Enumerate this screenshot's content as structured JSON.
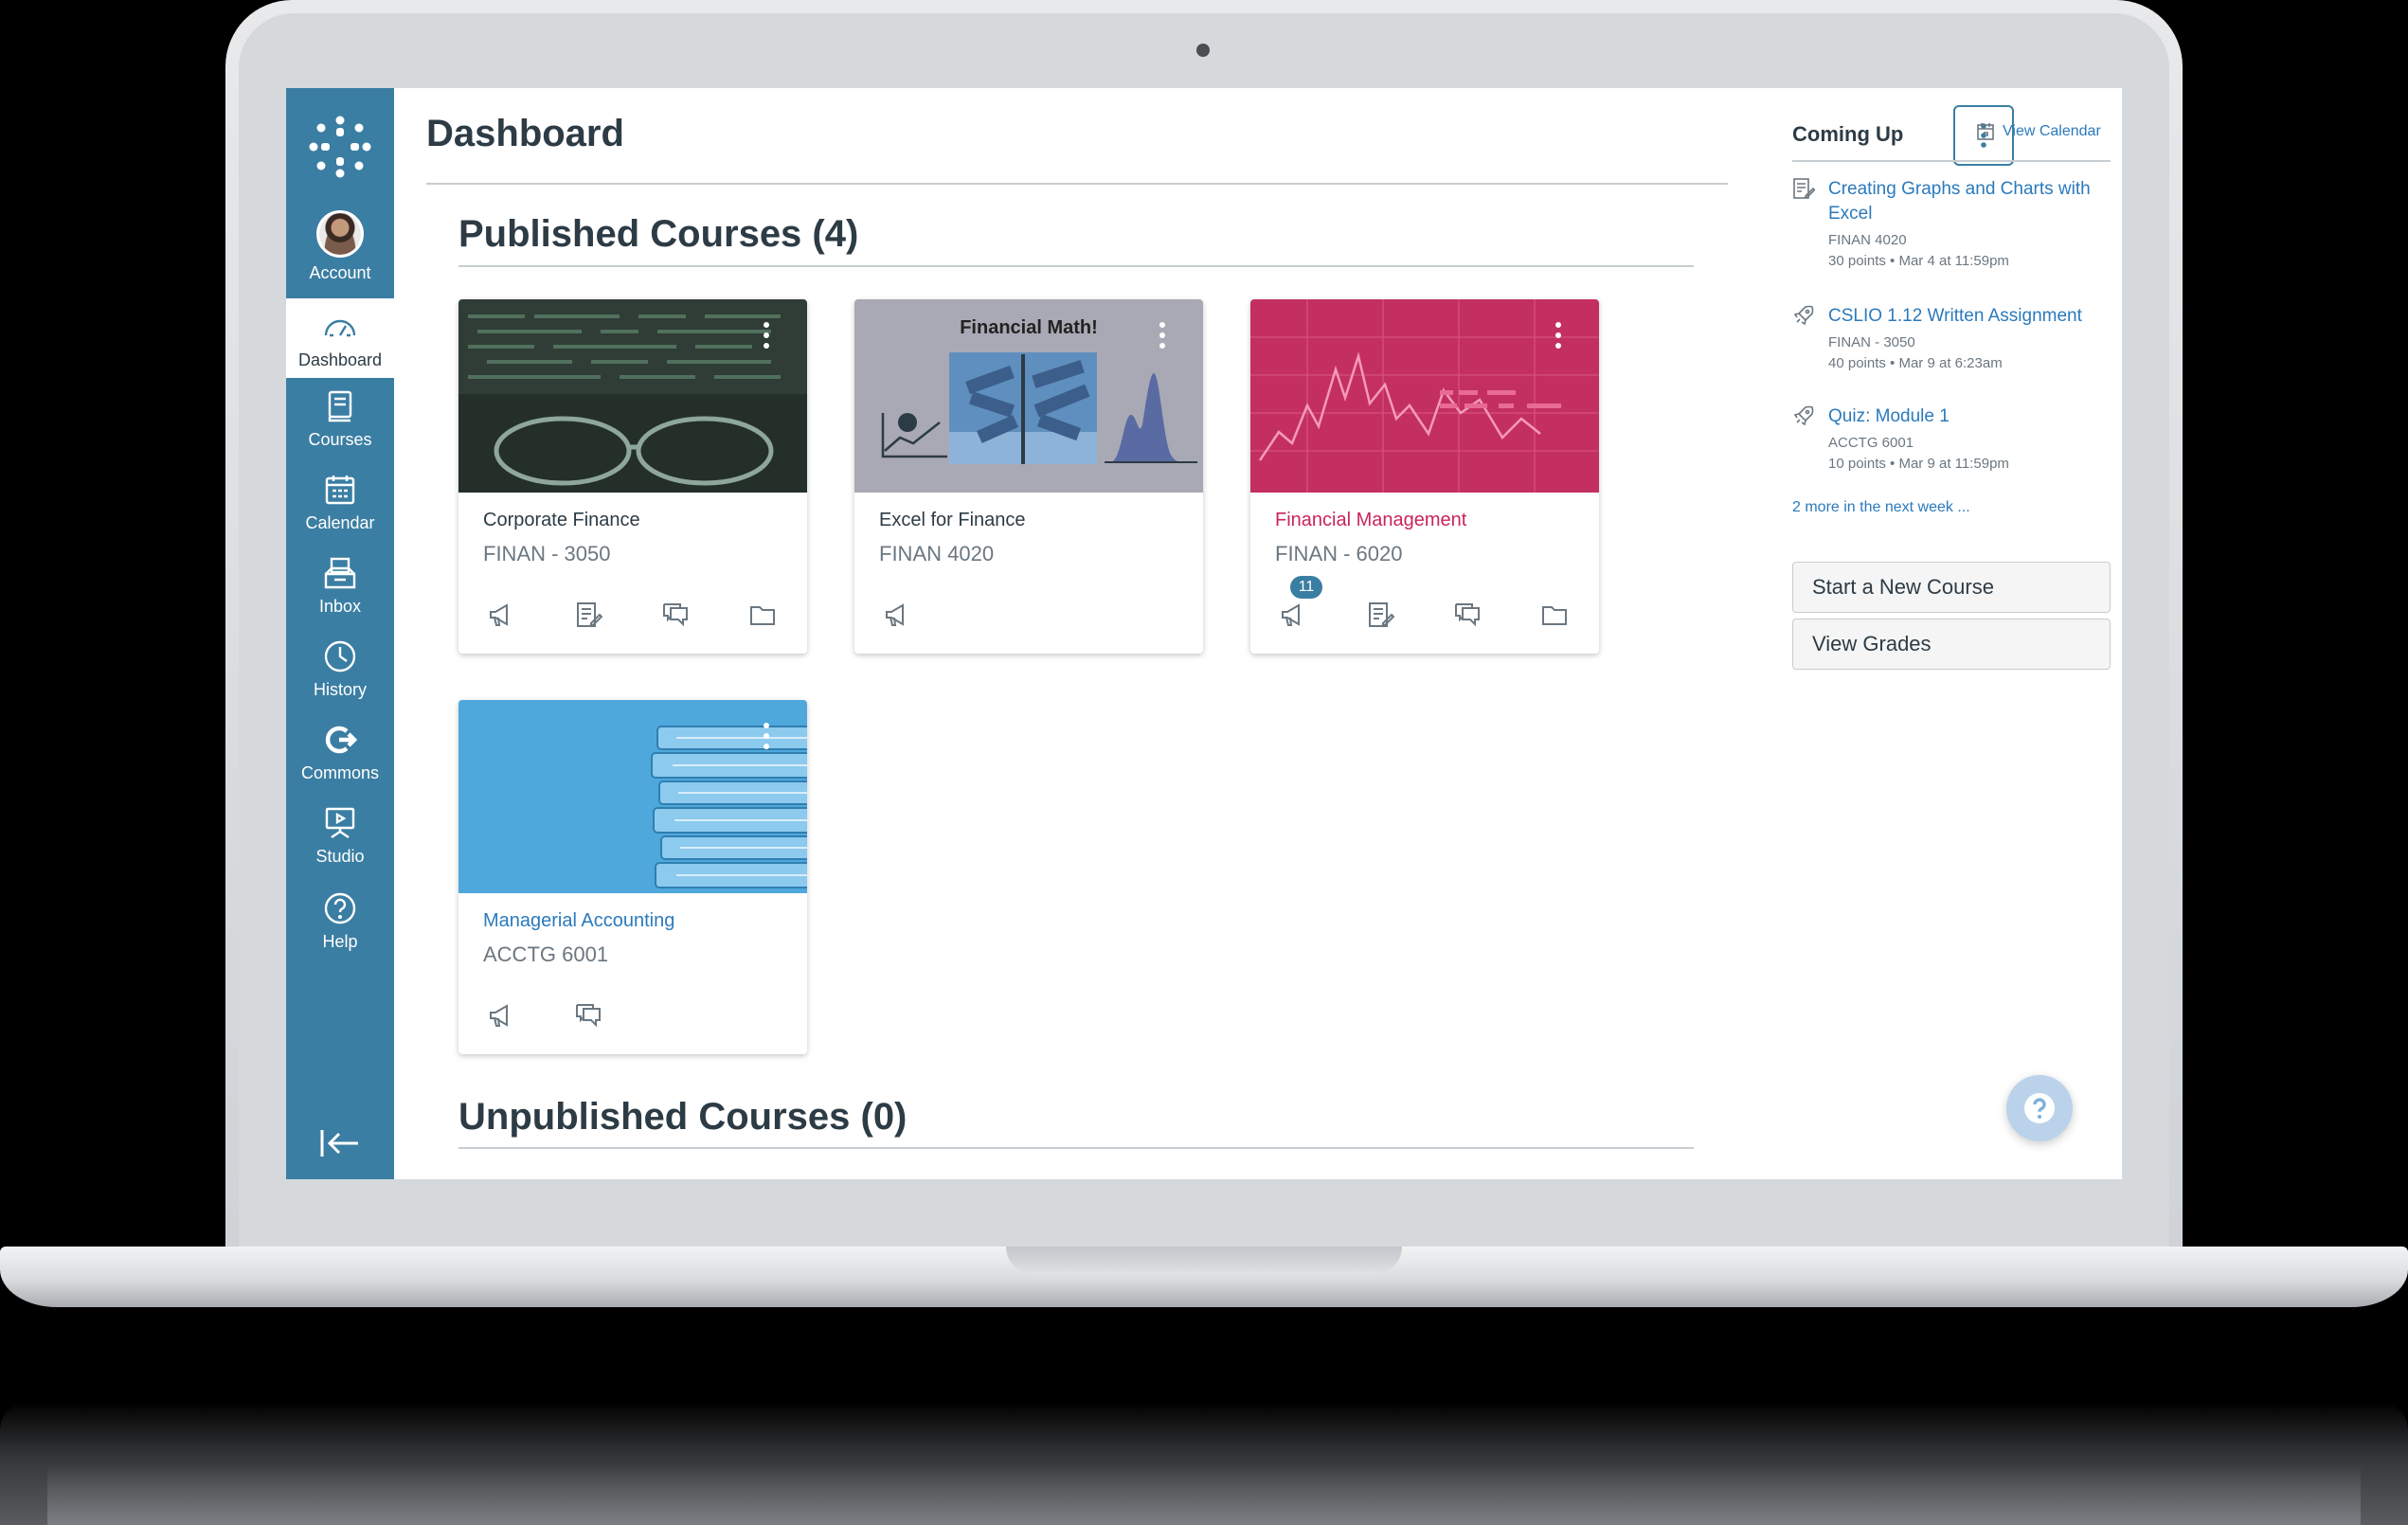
{
  "nav": {
    "items": [
      {
        "label": "Account"
      },
      {
        "label": "Dashboard"
      },
      {
        "label": "Courses"
      },
      {
        "label": "Calendar"
      },
      {
        "label": "Inbox"
      },
      {
        "label": "History"
      },
      {
        "label": "Commons"
      },
      {
        "label": "Studio"
      },
      {
        "label": "Help"
      }
    ],
    "active": "Dashboard"
  },
  "header": {
    "title": "Dashboard"
  },
  "published": {
    "title": "Published Courses (4)"
  },
  "unpublished": {
    "title": "Unpublished Courses (0)"
  },
  "courses": [
    {
      "title": "Corporate Finance",
      "code": "FINAN - 3050",
      "title_color": "#2d3b45"
    },
    {
      "title": "Excel for Finance",
      "code": "FINAN 4020",
      "hero_text": "Financial Math!",
      "title_color": "#2d3b45"
    },
    {
      "title": "Financial Management",
      "code": "FINAN - 6020",
      "badge": "11",
      "title_color": "#c9245f"
    },
    {
      "title": "Managerial Accounting",
      "code": "ACCTG 6001",
      "title_color": "#2b7abc"
    }
  ],
  "coming_up": {
    "title": "Coming Up",
    "view_calendar": "View Calendar",
    "items": [
      {
        "title": "Creating Graphs and Charts with Excel",
        "course": "FINAN 4020",
        "detail": "30 points • Mar 4 at 11:59pm",
        "icon": "assignment-icon"
      },
      {
        "title": "CSLIO 1.12 Written Assignment",
        "course": "FINAN - 3050",
        "detail": "40 points • Mar 9 at 6:23am",
        "icon": "quiz-rocket-icon"
      },
      {
        "title": "Quiz: Module 1",
        "course": "ACCTG 6001",
        "detail": "10 points • Mar 9 at 11:59pm",
        "icon": "quiz-rocket-icon"
      }
    ],
    "more": "2 more in the next week ..."
  },
  "buttons": {
    "new_course": "Start a New Course",
    "view_grades": "View Grades"
  },
  "colors": {
    "nav_bg": "#3b7ea3",
    "link": "#2b7abc",
    "accent_pink": "#c9245f"
  }
}
